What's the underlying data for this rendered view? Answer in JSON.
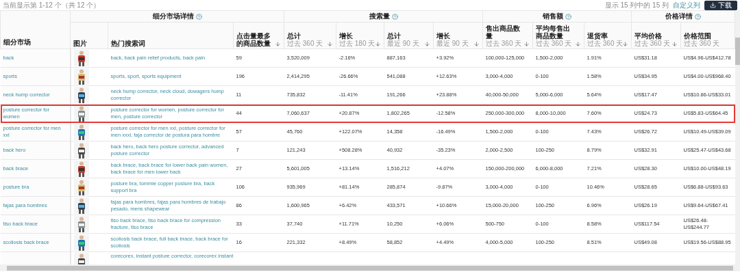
{
  "top_bar": {
    "result_text": "当前显示第 1-12 个（共 12 个）",
    "columns_text": "显示 15 列中的 15 列",
    "customize_link": "自定义列",
    "download_button": "下载"
  },
  "table": {
    "first_column": {
      "label": "细分市场"
    },
    "groups": [
      {
        "label": "细分市场详情",
        "columns": [
          {
            "label": "图片",
            "kind": "picture"
          },
          {
            "label": "热门搜索词",
            "kind": "link"
          },
          {
            "label": "点击量最多的商品数量",
            "kind": "number",
            "sortable": true
          }
        ]
      },
      {
        "label": "搜索量",
        "columns": [
          {
            "label": "总计",
            "sub": "过去 360 天",
            "kind": "number",
            "sortable": true
          },
          {
            "label": "增长",
            "sub": "过去 180 天",
            "kind": "number",
            "sortable": true
          },
          {
            "label": "总计",
            "sub": "最近 90 天",
            "kind": "number",
            "sortable": true
          },
          {
            "label": "增长",
            "sub": "最近 90 天",
            "kind": "number",
            "sortable": true
          }
        ]
      },
      {
        "label": "销售额",
        "columns": [
          {
            "label": "售出商品数量",
            "sub": "过去 360 天",
            "kind": "number",
            "sortable": true
          },
          {
            "label": "平均每售出商品数量",
            "sub": "过去 360 天",
            "kind": "number",
            "sortable": true
          },
          {
            "label": "退货率",
            "sub": "过去 360 天",
            "kind": "number",
            "sortable": true
          }
        ]
      },
      {
        "label": "价格详情",
        "columns": [
          {
            "label": "平均价格",
            "sub": "过去 360 天",
            "kind": "number",
            "sortable": true
          },
          {
            "label": "价格范围",
            "sub": "过去 360 天",
            "kind": "number",
            "sortable": false
          }
        ]
      }
    ],
    "rows": [
      {
        "market": "back",
        "highlighted": false,
        "keywords": "back, back pain relief products, back pain",
        "values": [
          "59",
          "3,520,009",
          "-2.16%",
          "887,163",
          "+3.92%",
          "100,000-125,000",
          "1,500-2,000",
          "1.91%",
          "US$31.18",
          "US$4.96-US$412.78"
        ]
      },
      {
        "market": "sports",
        "highlighted": false,
        "keywords": "sports, sport, sports equipment",
        "values": [
          "196",
          "2,414,295",
          "-26.66%",
          "541,088",
          "+12.63%",
          "3,000-4,000",
          "0-100",
          "1.58%",
          "US$34.95",
          "US$4.00-US$968.40"
        ]
      },
      {
        "market": "neck hump corrector",
        "highlighted": false,
        "keywords": "neck hump corrector, neck cloud, dowagers hump corrector",
        "values": [
          "11",
          "735,832",
          "-11.41%",
          "191,266",
          "+23.88%",
          "40,000-50,000",
          "5,000-6,000",
          "5.64%",
          "US$17.47",
          "US$10.86-US$33.01"
        ]
      },
      {
        "market": "posture corrector for women",
        "highlighted": true,
        "keywords": "posture corrector for women, posture corrector for men, posture corrector",
        "values": [
          "44",
          "7,060,637",
          "+20.87%",
          "1,802,265",
          "-12.58%",
          "250,000-300,000",
          "8,000-10,000",
          "7.60%",
          "US$24.73",
          "US$5.83-US$64.45"
        ]
      },
      {
        "market": "posture corrector for men xxl",
        "highlighted": false,
        "keywords": "posture corrector for men xxl, posture corrector for men xxxl, faja corrector de postura para hombre",
        "values": [
          "57",
          "45,760",
          "+122.07%",
          "14,358",
          "-16.49%",
          "1,500-2,000",
          "0-100",
          "7.43%",
          "US$26.72",
          "US$10.49-US$39.09"
        ]
      },
      {
        "market": "back hero",
        "highlighted": false,
        "keywords": "back hero, back hero posture corrector, advanced posture corrector",
        "values": [
          "7",
          "121,243",
          "+508.28%",
          "40,932",
          "-35.23%",
          "2,000-2,500",
          "100-250",
          "8.79%",
          "US$32.91",
          "US$25.47-US$43.68"
        ]
      },
      {
        "market": "back brace",
        "highlighted": false,
        "keywords": "back brace, back brace for lower back pain women, back brace for men lower back",
        "values": [
          "27",
          "5,601,005",
          "+13.14%",
          "1,516,212",
          "+4.07%",
          "150,000-200,000",
          "6,000-8,000",
          "7.21%",
          "US$28.30",
          "US$10.00-US$48.19"
        ]
      },
      {
        "market": "posture bra",
        "highlighted": false,
        "keywords": "posture bra, tommie copper posture bra, back support bra",
        "values": [
          "106",
          "935,969",
          "+81.14%",
          "285,874",
          "-9.87%",
          "3,000-4,000",
          "0-100",
          "10.46%",
          "US$28.65",
          "US$6.88-US$93.63"
        ]
      },
      {
        "market": "fajas para hombres",
        "highlighted": false,
        "keywords": "fajas para hombres, fajas para hombres de trabajo pesado, mens shapewear",
        "values": [
          "86",
          "1,600,965",
          "+6.42%",
          "433,571",
          "+10.66%",
          "15,000-20,000",
          "100-250",
          "6.96%",
          "US$26.19",
          "US$9.64-US$67.41"
        ]
      },
      {
        "market": "tlso back brace",
        "highlighted": false,
        "keywords": "tlso back brace, tlso back brace for compression fracture, tlso brace",
        "values": [
          "33",
          "37,740",
          "+11.71%",
          "10,250",
          "+6.06%",
          "500-750",
          "0-100",
          "8.58%",
          "US$117.54",
          "US$26.48-US$244.77"
        ]
      },
      {
        "market": "scoliosis back brace",
        "highlighted": false,
        "keywords": "scoliosis back brace, full back brace, back brace for scoliosis",
        "values": [
          "16",
          "221,332",
          "+8.49%",
          "58,852",
          "+4.49%",
          "4,000-5,000",
          "100-250",
          "8.51%",
          "US$49.08",
          "US$19.56-US$88.95"
        ]
      },
      {
        "highlighted": false,
        "keywords": "corecorex, instant posture corrector, corecorex instant"
      }
    ]
  }
}
